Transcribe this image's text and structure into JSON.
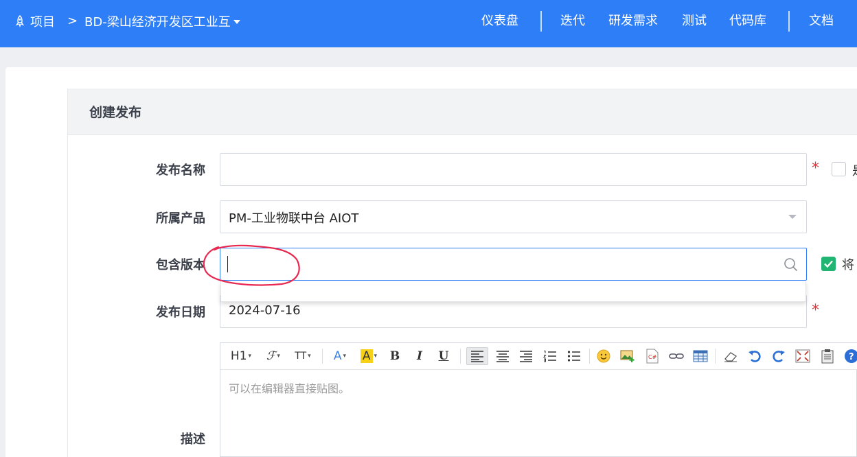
{
  "topbar": {
    "home_label": "项目",
    "breadcrumb_sep": ">",
    "project_name": "BD-梁山经济开发区工业互",
    "nav": [
      "仪表盘",
      "迭代",
      "研发需求",
      "测试",
      "代码库",
      "文档"
    ]
  },
  "panel": {
    "title": "创建发布"
  },
  "form": {
    "name_label": "发布名称",
    "name_value": "",
    "required_mark": "*",
    "name_checkbox_text": "是",
    "product_label": "所属产品",
    "product_value": "PM-工业物联中台 AIOT",
    "version_label": "包含版本",
    "version_value": "",
    "version_checkbox_text": "将",
    "date_label": "发布日期",
    "date_value": "2024-07-16",
    "desc_label": "描述"
  },
  "editor": {
    "placeholder": "可以在编辑器直接贴图。",
    "toolbar": {
      "heading": "H1",
      "font_family": "ℱ",
      "font_size": "TT",
      "font_color": "A",
      "bg_color": "A",
      "bold": "B",
      "italic": "I",
      "underline": "U"
    }
  },
  "colors": {
    "brand": "#2e7ff7",
    "required": "#e5363a",
    "check_on": "#21b573",
    "annotation": "#e8284e"
  }
}
